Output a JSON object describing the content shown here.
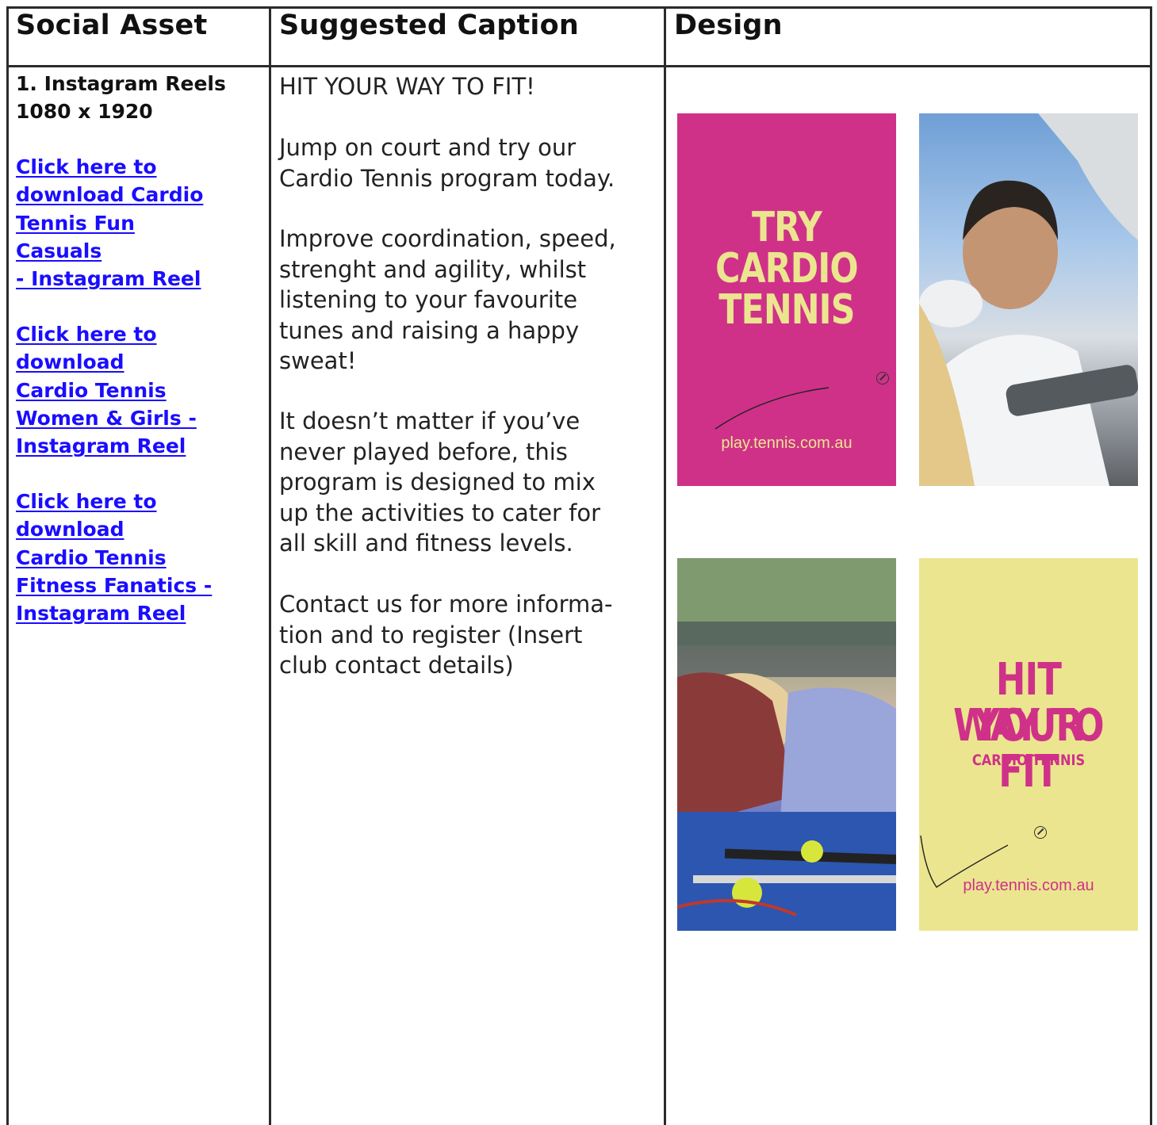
{
  "table": {
    "headers": {
      "social_asset": "Social Asset",
      "suggested_caption": "Suggested Caption",
      "design": "Design"
    },
    "row1": {
      "asset_title_line1": "1. Instagram Reels",
      "asset_title_line2": "1080 x 1920",
      "links": [
        {
          "line1": "Click here to",
          "line2": "download Cardio",
          "line3": "Tennis Fun",
          "line4": "Casuals",
          "line5": "- Instagram Reel"
        },
        {
          "line1": "Click here to",
          "line2": "download",
          "line3": "Cardio Tennis",
          "line4": "Women & Girls -",
          "line5": "Instagram Reel"
        },
        {
          "line1": "Click here to",
          "line2": "download",
          "line3": "Cardio Tennis",
          "line4": "Fitness Fanatics -",
          "line5": "Instagram Reel"
        }
      ],
      "caption": {
        "p1": "HIT YOUR WAY TO FIT!",
        "p2_l1": "Jump on court and try our",
        "p2_l2": "Cardio Tennis program today.",
        "p3_l1": "Improve coordination, speed,",
        "p3_l2": "strenght and agility, whilst",
        "p3_l3": "listening to your favourite",
        "p3_l4": "tunes and raising a happy",
        "p3_l5": "sweat!",
        "p4_l1": "It doesn’t matter if you’ve",
        "p4_l2": "never played before, this",
        "p4_l3": "program is designed to mix",
        "p4_l4": "up the activities to cater for",
        "p4_l5": "all skill and fitness levels.",
        "p5_l1": "Contact us for more informa-",
        "p5_l2": "tion and to register (Insert",
        "p5_l3": "club contact details)"
      },
      "designs": {
        "card1": {
          "l1": "TRY",
          "l2": "CARDIO",
          "l3": "TENNIS",
          "url": "play.tennis.com.au"
        },
        "card4": {
          "l1": "HIT YOUR",
          "l2": "WAY TO FIT",
          "sub": "CARDIO TENNIS",
          "url": "play.tennis.com.au"
        }
      }
    }
  },
  "colors": {
    "link": "#1a0dff",
    "brand_pink": "#cf3189",
    "brand_yellow": "#ece58f",
    "border": "#2b2b2b"
  }
}
